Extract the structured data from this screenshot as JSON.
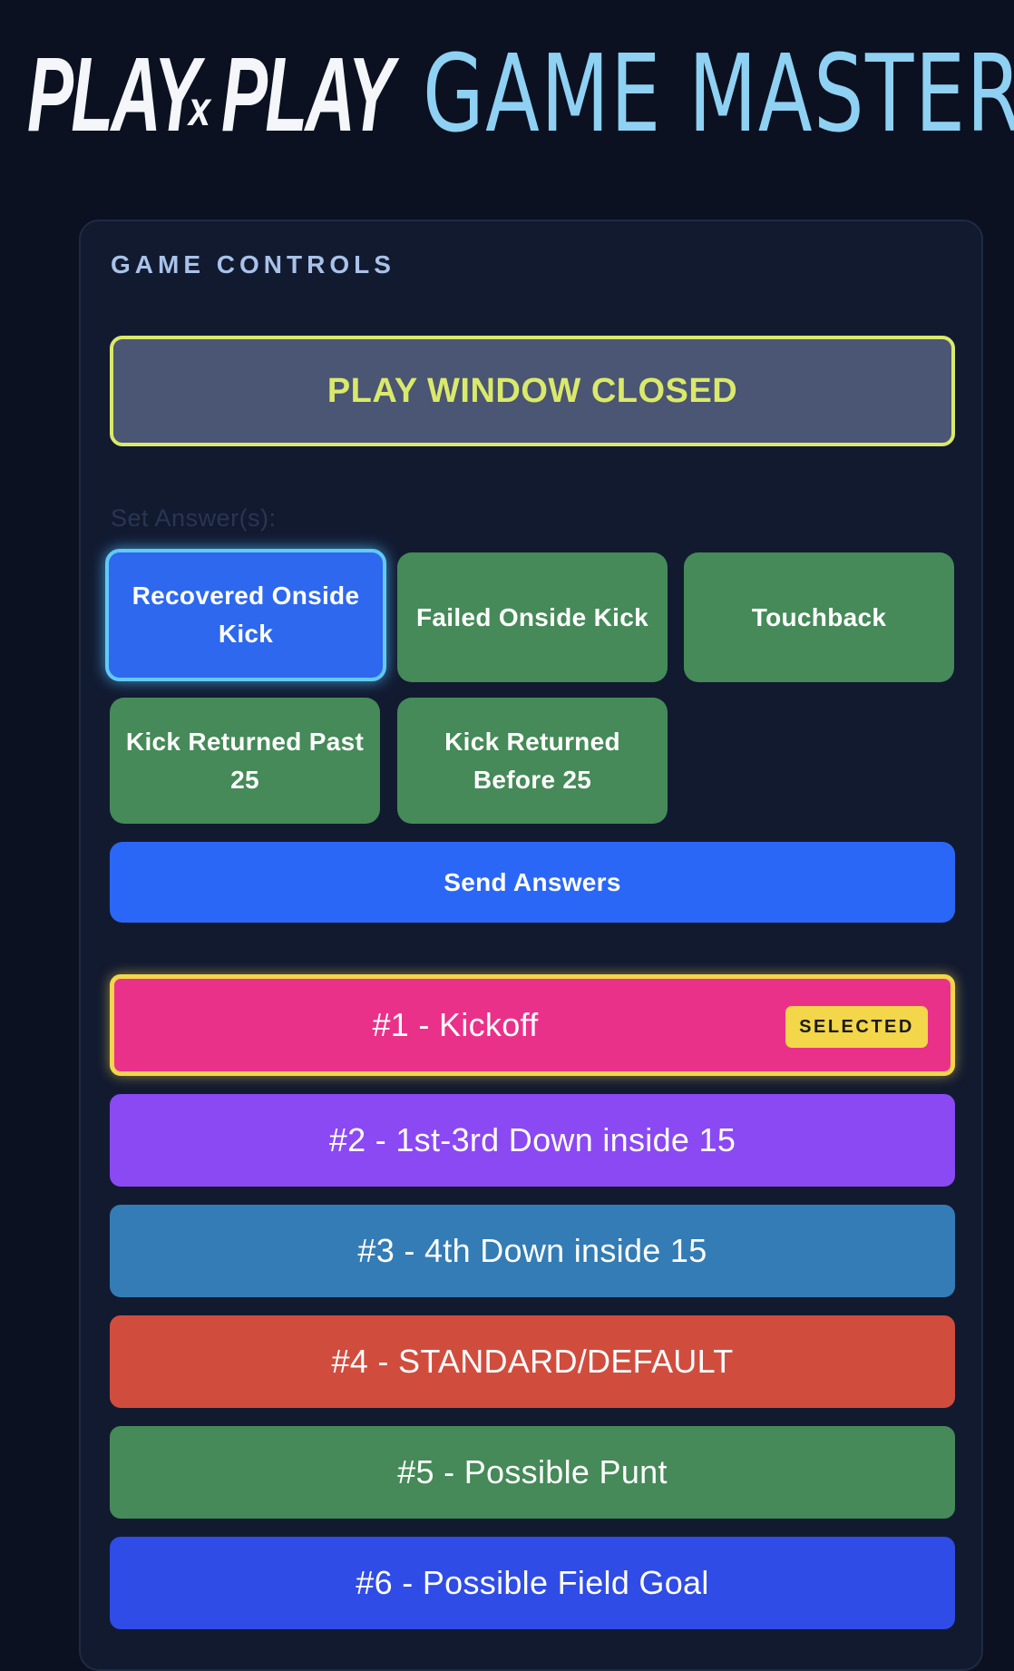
{
  "header": {
    "logo_part1": "PLAY",
    "logo_x": "x",
    "logo_part2": "PLAY",
    "title": "GAME MASTER"
  },
  "panel": {
    "title": "GAME CONTROLS",
    "status": "PLAY WINDOW CLOSED",
    "answers_label": "Set Answer(s):",
    "answers": [
      {
        "label": "Recovered Onside Kick",
        "selected": true
      },
      {
        "label": "Failed Onside Kick",
        "selected": false
      },
      {
        "label": "Touchback",
        "selected": false
      },
      {
        "label": "Kick Returned Past 25",
        "selected": false
      },
      {
        "label": "Kick Returned Before 25",
        "selected": false
      }
    ],
    "send_label": "Send Answers",
    "plays": [
      {
        "label": "#1 - Kickoff",
        "color": "#ea318a",
        "selected": true,
        "badge": "SELECTED"
      },
      {
        "label": "#2 - 1st-3rd Down inside 15",
        "color": "#8b49f3",
        "selected": false
      },
      {
        "label": "#3 - 4th Down inside 15",
        "color": "#347cb5",
        "selected": false
      },
      {
        "label": "#4 - STANDARD/DEFAULT",
        "color": "#d04d3e",
        "selected": false
      },
      {
        "label": "#5 - Possible Punt",
        "color": "#458a58",
        "selected": false
      },
      {
        "label": "#6 - Possible Field Goal",
        "color": "#2f4ce6",
        "selected": false
      }
    ]
  },
  "colors": {
    "background": "#0b1120",
    "panel": "#121a30",
    "status_accent": "#dbe96a",
    "answer_green": "#458a58",
    "answer_selected": "#2d68ef",
    "send_blue": "#2b67f6",
    "title_blue": "#8ed1f3"
  }
}
